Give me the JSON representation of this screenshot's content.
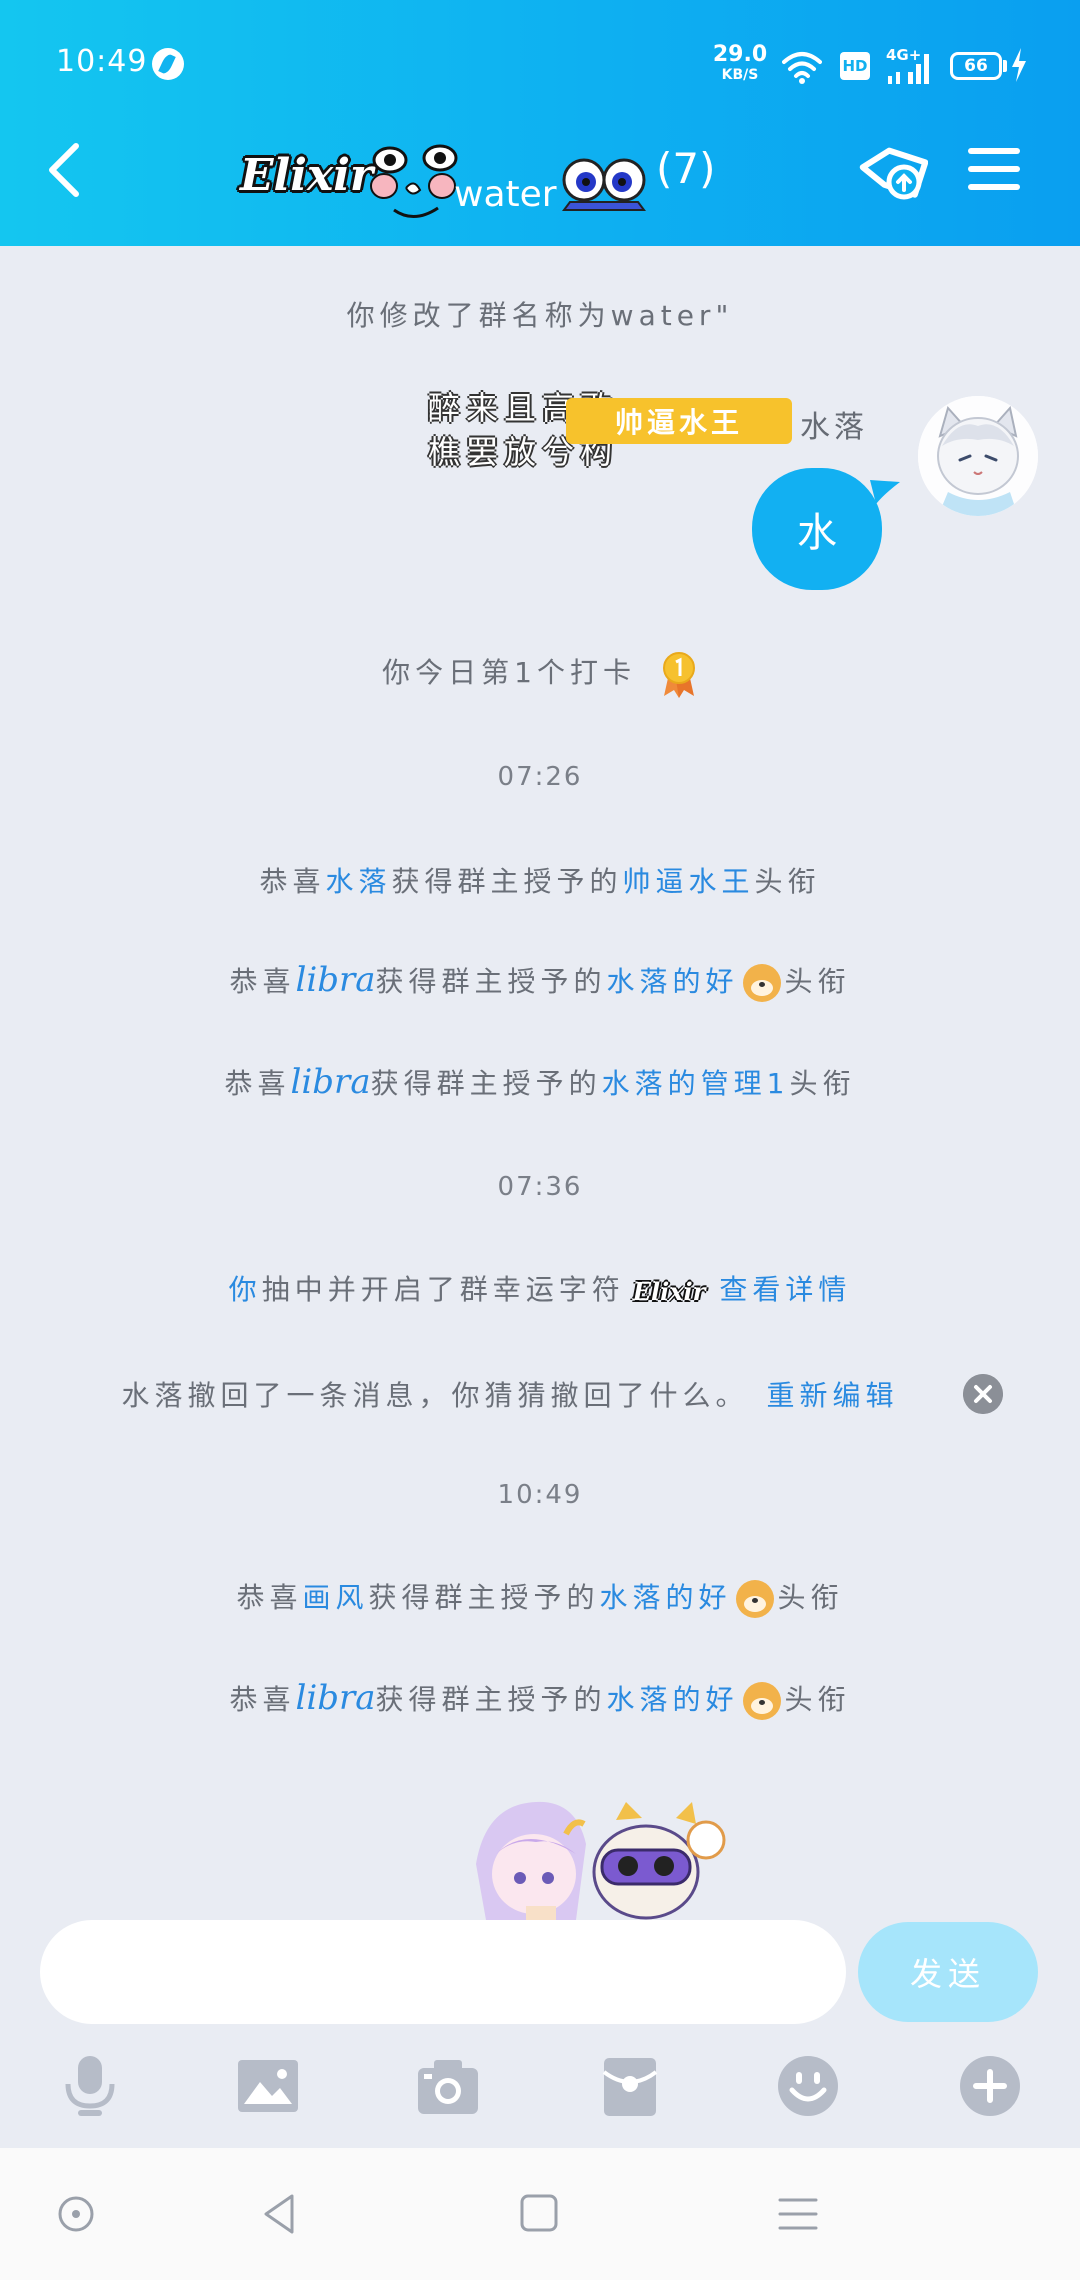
{
  "status_bar": {
    "time": "10:49",
    "net_speed_value": "29.0",
    "net_speed_unit": "KB/S",
    "hd": "HD",
    "network": "4G+",
    "battery": "66"
  },
  "header": {
    "title_brand": "Elixir",
    "title_word": "water",
    "member_count": "(7)"
  },
  "chat": {
    "rename_notice": "你修改了群名称为water\"",
    "message": {
      "sender_overlay_line1": "醉来且高歌",
      "sender_overlay_line2": "樵罢放兮构",
      "title_badge": "帅逼水王",
      "sender_name": "水落",
      "text": "水"
    },
    "checkin": "你今日第1个打卡",
    "ts1": "07:26",
    "g1": {
      "pre": "恭喜",
      "name": "水落",
      "mid": "获得群主授予的",
      "title": "帅逼水王",
      "post": "头衔"
    },
    "g2": {
      "pre": "恭喜",
      "name": "libra",
      "mid": "获得群主授予的",
      "title": "水落的好",
      "post": "头衔"
    },
    "g3": {
      "pre": "恭喜",
      "name": "libra",
      "mid": "获得群主授予的",
      "title": "水落的管理1",
      "post": "头衔"
    },
    "ts2": "07:36",
    "lucky": {
      "you": "你",
      "text": "抽中并开启了群幸运字符",
      "char": "Elixir",
      "link": "查看详情"
    },
    "retract": {
      "text": "水落撤回了一条消息，你猜猜撤回了什么。",
      "link": "重新编辑"
    },
    "ts3": "10:49",
    "g4": {
      "pre": "恭喜",
      "name": "画风",
      "mid": "获得群主授予的",
      "title": "水落的好",
      "post": "头衔"
    },
    "g5": {
      "pre": "恭喜",
      "name": "libra",
      "mid": "获得群主授予的",
      "title": "水落的好",
      "post": "头衔"
    }
  },
  "input": {
    "placeholder": "",
    "send_label": "发送"
  },
  "colors": {
    "header_start": "#14c6f0",
    "header_end": "#0a9ff0",
    "accent": "#2a8ae0",
    "bubble": "#12b0f2",
    "send_disabled": "#a6e5fb",
    "badge": "#f7c22c"
  }
}
